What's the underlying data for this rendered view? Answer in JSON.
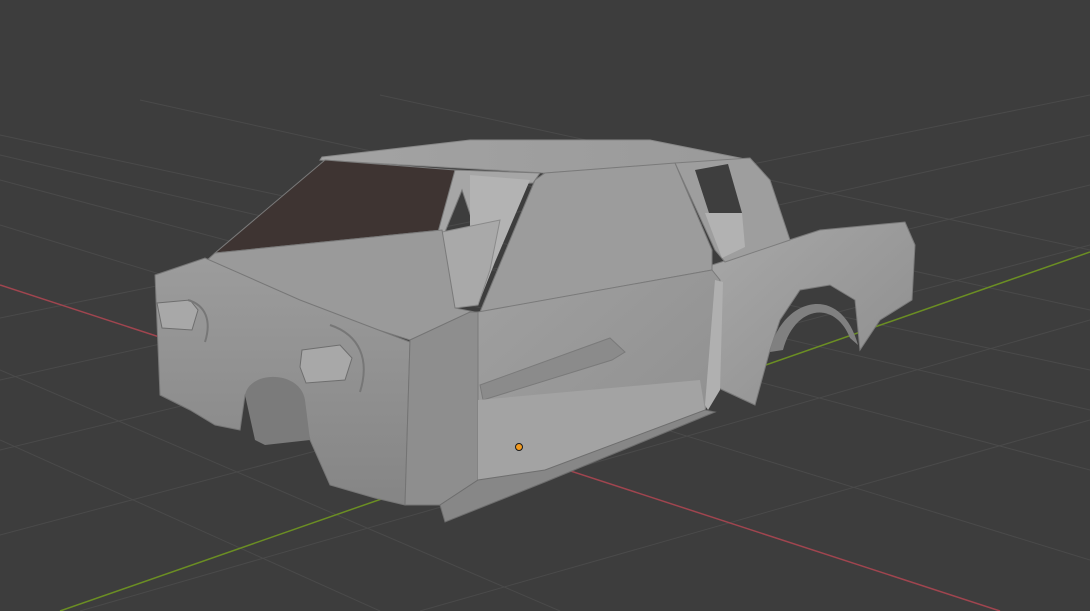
{
  "viewport": {
    "kind": "3d-viewport",
    "background_color": "#3d3d3d",
    "grid_line_color": "#4a4a4a",
    "x_axis_color": "#a0454f",
    "y_axis_color": "#6b8e23",
    "origin_color": "#f29a1f",
    "model": {
      "name": "car-body",
      "shading": "solid",
      "body_color": "#9a9a9a",
      "glass_color": "#3e3432"
    }
  }
}
